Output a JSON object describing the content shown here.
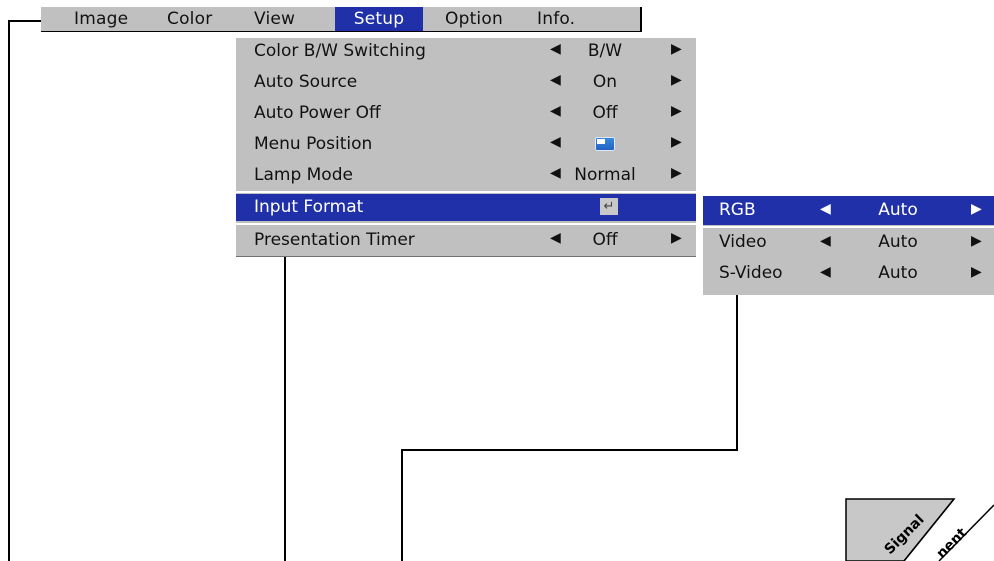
{
  "menubar": {
    "tabs": [
      {
        "label": "Image",
        "active": false
      },
      {
        "label": "Color",
        "active": false
      },
      {
        "label": "View",
        "active": false
      },
      {
        "label": "Setup",
        "active": true
      },
      {
        "label": "Option",
        "active": false
      },
      {
        "label": "Info.",
        "active": false
      }
    ]
  },
  "setup_menu": {
    "items": [
      {
        "label": "Color B/W Switching",
        "value": "B/W"
      },
      {
        "label": "Auto Source",
        "value": "On"
      },
      {
        "label": "Auto Power Off",
        "value": "Off"
      },
      {
        "label": "Menu Position",
        "value_icon": "menu-position-icon"
      },
      {
        "label": "Lamp Mode",
        "value": "Normal"
      },
      {
        "label": "Input Format",
        "value_icon": "enter-icon",
        "selected": true
      },
      {
        "label": "Presentation Timer",
        "value": "Off"
      }
    ]
  },
  "input_format_submenu": {
    "items": [
      {
        "label": "RGB",
        "value": "Auto",
        "selected": true
      },
      {
        "label": "Video",
        "value": "Auto"
      },
      {
        "label": "S-Video",
        "value": "Auto"
      }
    ]
  },
  "arrows": {
    "left": "◀",
    "right": "▶"
  },
  "enter_glyph": "↵",
  "badge": {
    "line1": "Signal",
    "line2": "nent"
  },
  "colors": {
    "menu_bg": "#c0c0c0",
    "highlight": "#2030a8",
    "highlight_text": "#ffffff"
  }
}
